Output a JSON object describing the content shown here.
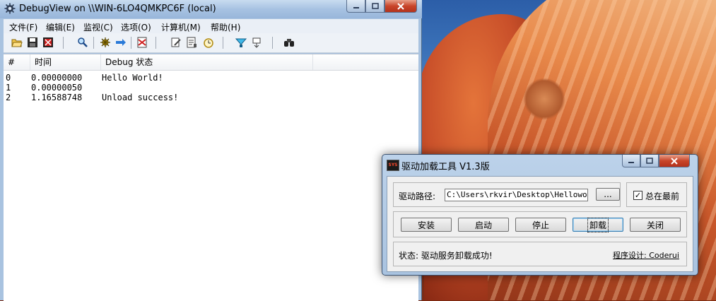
{
  "debugview": {
    "title": "DebugView on \\\\WIN-6LO4QMKPC6F (local)",
    "menu": [
      "文件(F)",
      "编辑(E)",
      "监视(C)",
      "选项(O)",
      "计算机(M)",
      "帮助(H)"
    ],
    "toolbar_icons": [
      "open-icon",
      "save-icon",
      "clear-icon",
      "find-icon",
      "capture-icon",
      "autoscroll-icon",
      "filter-icon",
      "edit-filter-icon",
      "log-icon",
      "clock-icon",
      "highlight-icon",
      "history-icon",
      "binoculars-icon"
    ],
    "columns": [
      "#",
      "时间",
      "Debug 状态"
    ],
    "rows": [
      {
        "num": "0",
        "time": "0.00000000",
        "msg": "Hello World!"
      },
      {
        "num": "1",
        "time": "0.00000050",
        "msg": ""
      },
      {
        "num": "2",
        "time": "1.16588748",
        "msg": "Unload success!"
      }
    ]
  },
  "dialog": {
    "title": "驱动加载工具 V1.3版",
    "icon_text": "SYS",
    "path_label": "驱动路径:",
    "path_value": "C:\\Users\\rkvir\\Desktop\\Helloworld.",
    "browse_label": "...",
    "topmost_label": "总在最前",
    "topmost_checked": true,
    "buttons": {
      "install": "安装",
      "start": "启动",
      "stop": "停止",
      "unload": "卸载",
      "close": "关闭"
    },
    "status": "状态: 驱动服务卸载成功!",
    "credit": "程序设计: Coderui"
  }
}
